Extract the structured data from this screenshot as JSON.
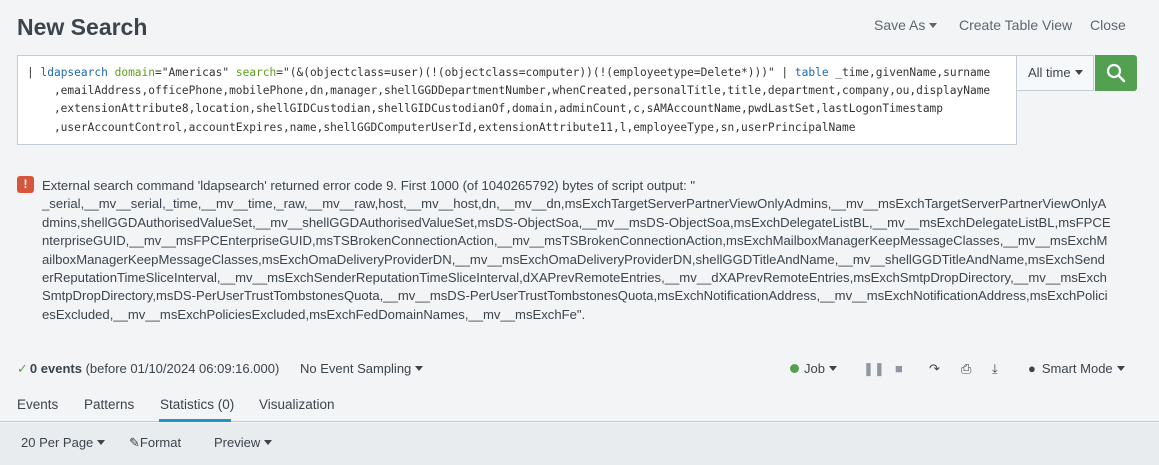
{
  "header": {
    "title": "New Search",
    "save_as": "Save As",
    "create_table_view": "Create Table View",
    "close": "Close"
  },
  "search": {
    "pipe": "| ",
    "cmd": "ldapsearch",
    "arg1_key": "domain",
    "arg1_val": "=\"Americas\" ",
    "arg2_key": "search",
    "arg2_val": "=\"(&(objectclass=user)(!(objectclass=computer))(!(employeetype=Delete*)))\" | ",
    "table_cmd": "table",
    "fields_line1": " _time,givenName,surname",
    "line2": "    ,emailAddress,officePhone,mobilePhone,dn,manager,shellGGDDepartmentNumber,whenCreated,personalTitle,title,department,company,ou,displayName",
    "line3": "    ,extensionAttribute8,location,shellGIDCustodian,shellGIDCustodianOf,domain,adminCount,c,sAMAccountName,pwdLastSet,lastLogonTimestamp",
    "line4": "    ,userAccountControl,accountExpires,name,shellGGDComputerUserId,extensionAttribute11,l,employeeType,sn,userPrincipalName"
  },
  "time_picker": {
    "label": "All time"
  },
  "error": {
    "icon": "!",
    "message": "External search command 'ldapsearch' returned error code 9. First 1000 (of 1040265792) bytes of script output: \"\n_serial,__mv__serial,_time,__mv__time,_raw,__mv__raw,host,__mv__host,dn,__mv__dn,msExchTargetServerPartnerViewOnlyAdmins,__mv__msExchTargetServerPartnerViewOnlyAdmins,shellGGDAuthorisedValueSet,__mv__shellGGDAuthorisedValueSet,msDS-ObjectSoa,__mv__msDS-ObjectSoa,msExchDelegateListBL,__mv__msExchDelegateListBL,msFPCEnterpriseGUID,__mv__msFPCEnterpriseGUID,msTSBrokenConnectionAction,__mv__msTSBrokenConnectionAction,msExchMailboxManagerKeepMessageClasses,__mv__msExchMailboxManagerKeepMessageClasses,msExchOmaDeliveryProviderDN,__mv__msExchOmaDeliveryProviderDN,shellGGDTitleAndName,__mv__shellGGDTitleAndName,msExchSenderReputationTimeSliceInterval,__mv__msExchSenderReputationTimeSliceInterval,dXAPrevRemoteEntries,__mv__dXAPrevRemoteEntries,msExchSmtpDropDirectory,__mv__msExchSmtpDropDirectory,msDS-PerUserTrustTombstonesQuota,__mv__msDS-PerUserTrustTombstonesQuota,msExchNotificationAddress,__mv__msExchNotificationAddress,msExchPoliciesExcluded,__mv__msExchPoliciesExcluded,msExchFedDomainNames,__mv__msExchFe\"."
  },
  "status": {
    "check": "✓",
    "events_bold": "0 events",
    "events_rest": " (before 01/10/2024 06:09:16.000)",
    "sampling": "No Event Sampling",
    "job": "Job",
    "smart_mode": "Smart Mode"
  },
  "tabs": [
    {
      "label": "Events"
    },
    {
      "label": "Patterns"
    },
    {
      "label": "Statistics (0)"
    },
    {
      "label": "Visualization"
    }
  ],
  "toolbar": {
    "per_page": "20 Per Page",
    "format": "Format",
    "preview": "Preview"
  },
  "colors": {
    "accent": "#53a051",
    "error": "#d6563c",
    "tab_active": "#1e93c6"
  }
}
